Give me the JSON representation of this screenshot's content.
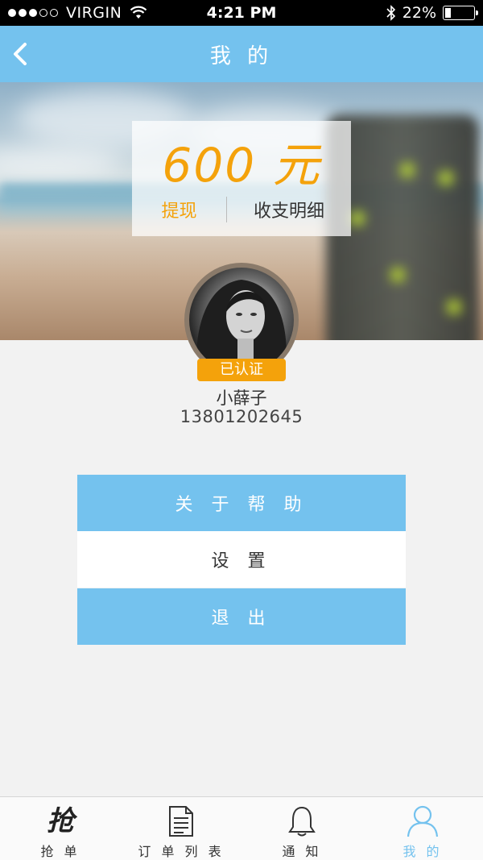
{
  "status_bar": {
    "carrier": "VIRGIN",
    "time": "4:21 PM",
    "battery": "22%",
    "battery_level": 0.22
  },
  "nav": {
    "title": "我 的",
    "back_icon": "chevron-left-icon"
  },
  "wallet": {
    "balance": "600 元",
    "withdraw_label": "提现",
    "details_label": "收支明细"
  },
  "profile": {
    "verified_label": "已认证",
    "name": "小薛子",
    "phone": "13801202645"
  },
  "menu": {
    "help_label": "关 于 帮 助",
    "settings_label": "设 置",
    "logout_label": "退 出"
  },
  "tabs": [
    {
      "label": "抢 单",
      "icon": "grab-order-icon",
      "glyph": "抢",
      "active": false
    },
    {
      "label": "订 单 列 表",
      "icon": "document-icon",
      "active": false
    },
    {
      "label": "通 知",
      "icon": "bell-icon",
      "active": false
    },
    {
      "label": "我 的",
      "icon": "user-icon",
      "active": true
    }
  ],
  "colors": {
    "accent": "#74c2ee",
    "highlight": "#f4a20b"
  }
}
